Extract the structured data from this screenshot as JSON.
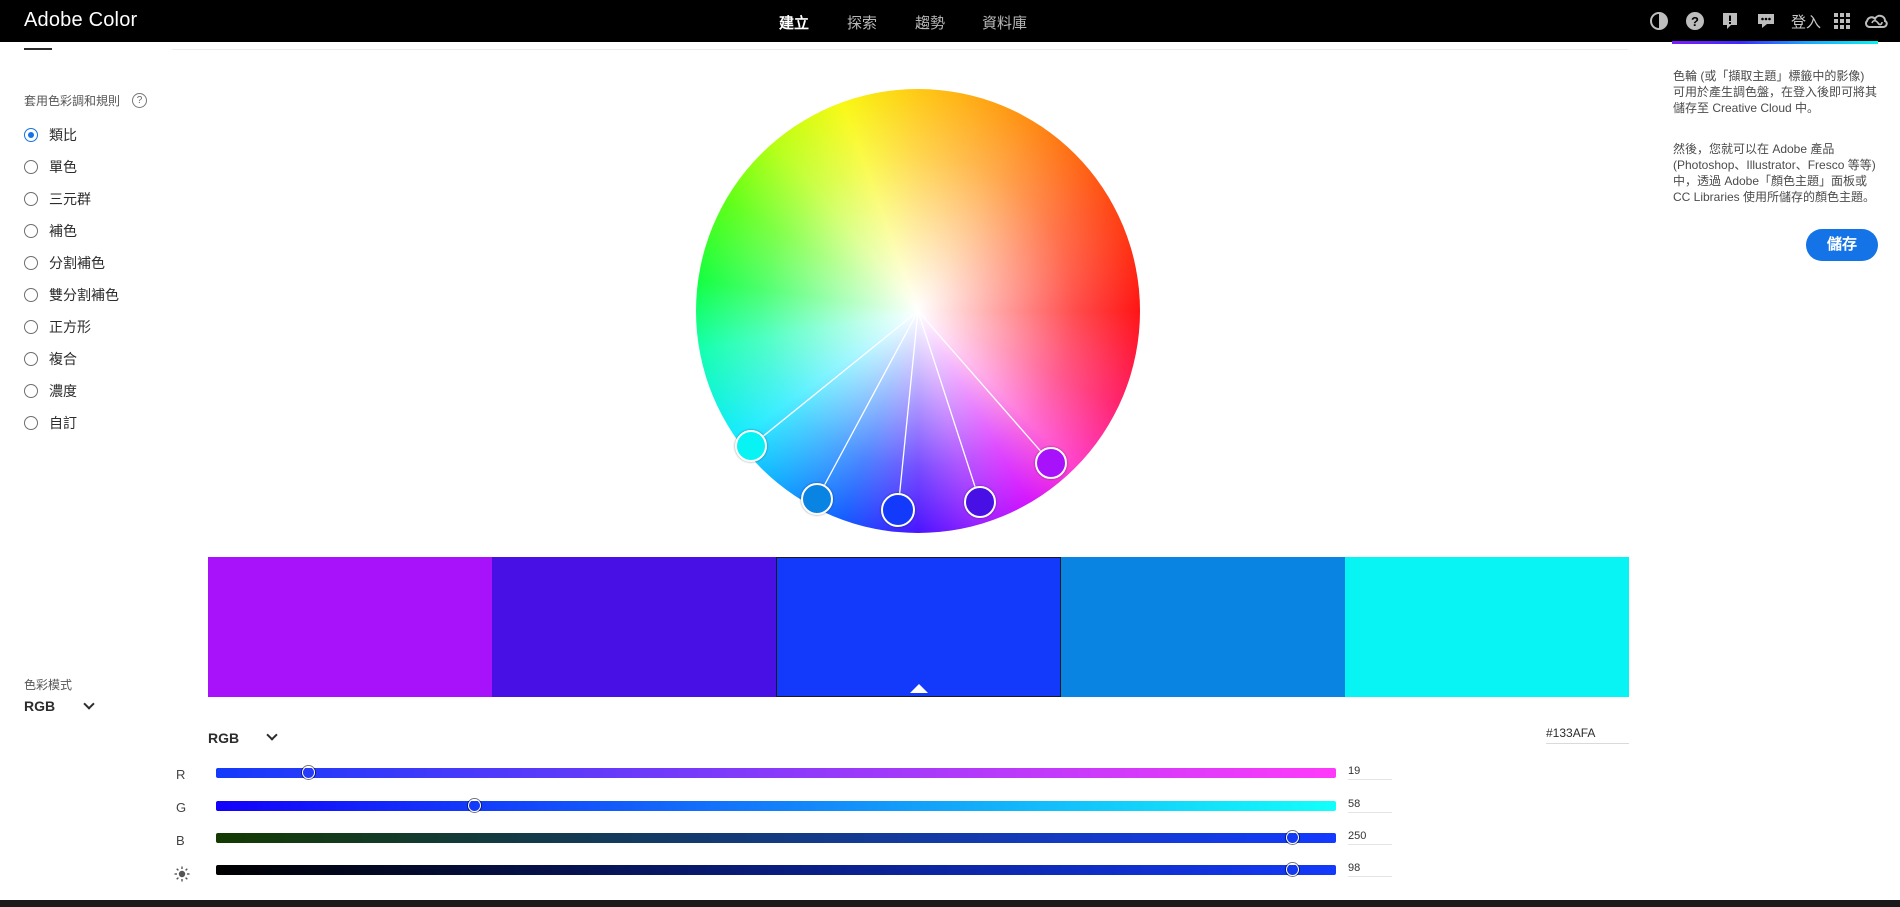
{
  "header": {
    "brand": "Adobe Color",
    "nav": [
      {
        "label": "建立",
        "active": true
      },
      {
        "label": "探索",
        "active": false
      },
      {
        "label": "趨勢",
        "active": false
      },
      {
        "label": "資料庫",
        "active": false
      }
    ],
    "icons": [
      "contrast-icon",
      "help-icon",
      "feedback-icon",
      "chat-icon"
    ],
    "signin_label": "登入",
    "app_icons": [
      "app-switcher-icon",
      "creative-cloud-icon"
    ]
  },
  "rules": {
    "title": "套用色彩調和規則",
    "help": "?",
    "selected": "類比",
    "items": [
      "類比",
      "單色",
      "三元群",
      "補色",
      "分割補色",
      "雙分割補色",
      "正方形",
      "複合",
      "濃度",
      "自訂"
    ]
  },
  "color_mode": {
    "title": "色彩模式",
    "value": "RGB"
  },
  "side_panel": {
    "paragraph1": "色輪 (或「擷取主題」標籤中的影像) 可用於產生調色盤，在登入後即可將其儲存至 Creative Cloud 中。",
    "paragraph2": "然後，您就可以在 Adobe 產品 (Photoshop、Illustrator、Fresco 等等) 中，透過 Adobe「顏色主題」面板或 CC Libraries 使用所儲存的顏色主題。",
    "save_label": "儲存"
  },
  "swatches": [
    {
      "hex": "#A712FA"
    },
    {
      "hex": "#4910E6"
    },
    {
      "hex": "#133AFA"
    },
    {
      "hex": "#0A84E3"
    },
    {
      "hex": "#08F4F4"
    }
  ],
  "selected_swatch_index": 2,
  "editor": {
    "mode_label": "RGB",
    "hex_value": "#133AFA",
    "channels": [
      {
        "label": "R",
        "value": 19,
        "max": 255,
        "from": "#133AFA",
        "to": "#FF3AFA"
      },
      {
        "label": "G",
        "value": 58,
        "max": 255,
        "from": "#1300FA",
        "to": "#13FFFA"
      },
      {
        "label": "B",
        "value": 250,
        "max": 255,
        "from": "#133A00",
        "to": "#133AFF"
      },
      {
        "label": "",
        "icon": "brightness-icon",
        "value": 98,
        "max": 100,
        "from": "#000000",
        "to": "#133AFA"
      }
    ]
  },
  "colors": {
    "topbar": "#000000",
    "accent": "#1473E6"
  }
}
